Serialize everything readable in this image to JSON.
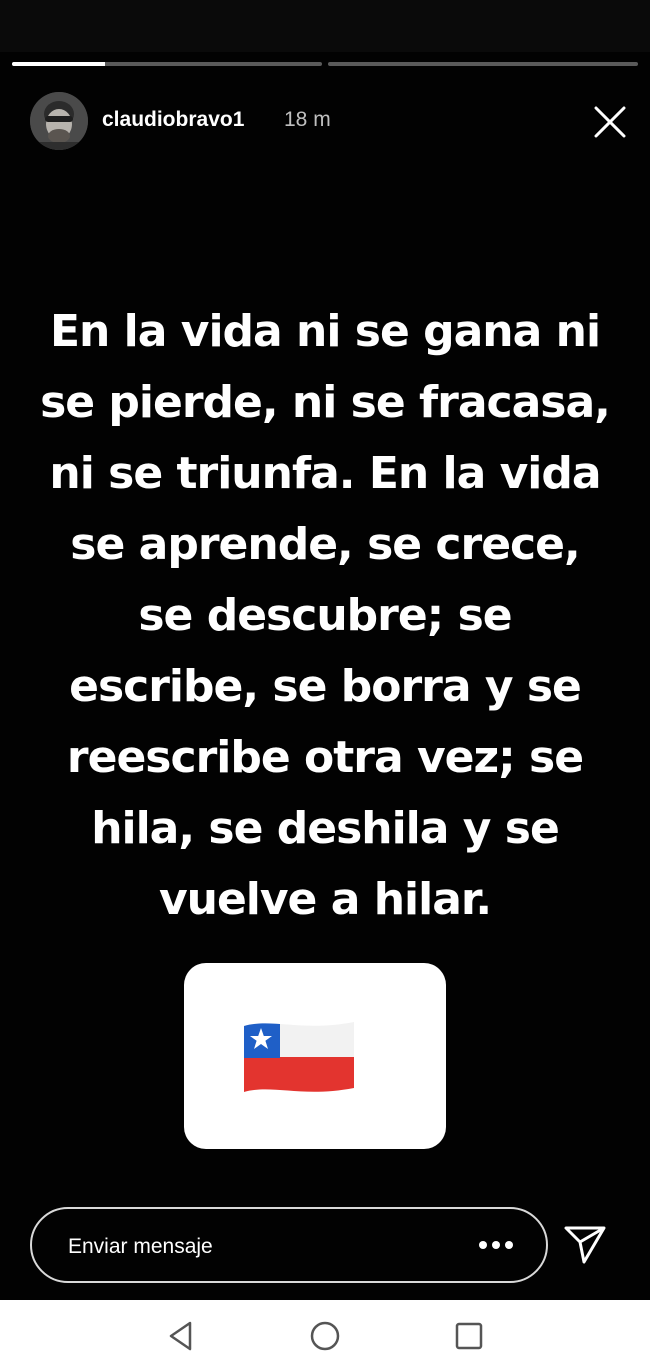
{
  "story": {
    "progress": [
      0.3,
      0
    ],
    "user": {
      "username": "claudiobravo1",
      "time": "18 m",
      "avatar_icon": "profile-photo"
    },
    "close_icon": "close-icon",
    "quote_lines": [
      "En la vida ni se gana ni",
      "se pierde, ni se fracasa,",
      "ni se triunfa. En la vida",
      "se aprende, se crece,",
      "se descubre; se",
      "escribe, se borra y se",
      "reescribe otra vez; se",
      "hila, se deshila y se",
      "vuelve a hilar."
    ],
    "sticker": {
      "emoji_icon": "chile-flag-icon",
      "colors": {
        "blue": "#1f5fc7",
        "white": "#ffffff",
        "red": "#e3342f"
      }
    },
    "reply": {
      "placeholder": "Enviar mensaje",
      "more_icon": "more-dots-icon",
      "send_icon": "send-icon"
    }
  },
  "nav": {
    "back_icon": "back-icon",
    "home_icon": "home-icon",
    "recents_icon": "recents-icon"
  }
}
